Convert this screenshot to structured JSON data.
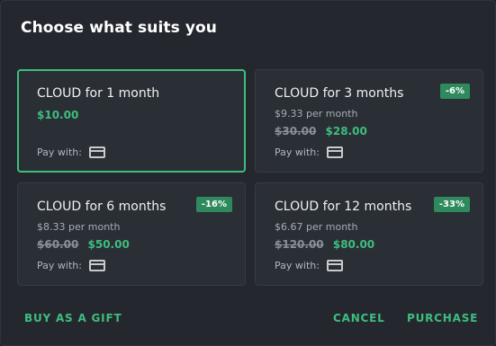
{
  "dialog": {
    "title": "Choose what suits you"
  },
  "plans": [
    {
      "name": "CLOUD for 1 month",
      "per_month": "",
      "old_price": "",
      "price": "$10.00",
      "discount": "",
      "pay_label": "Pay with:",
      "selected": true
    },
    {
      "name": "CLOUD for 3 months",
      "per_month": "$9.33 per month",
      "old_price": "$30.00",
      "price": "$28.00",
      "discount": "-6%",
      "pay_label": "Pay with:",
      "selected": false
    },
    {
      "name": "CLOUD for 6 months",
      "per_month": "$8.33 per month",
      "old_price": "$60.00",
      "price": "$50.00",
      "discount": "-16%",
      "pay_label": "Pay with:",
      "selected": false
    },
    {
      "name": "CLOUD for 12 months",
      "per_month": "$6.67 per month",
      "old_price": "$120.00",
      "price": "$80.00",
      "discount": "-33%",
      "pay_label": "Pay with:",
      "selected": false
    }
  ],
  "payment_icon": "credit-card-icon",
  "footer": {
    "gift_label": "BUY AS A GIFT",
    "cancel_label": "CANCEL",
    "purchase_label": "PURCHASE"
  },
  "colors": {
    "accent": "#3fbd7f",
    "badge": "#2e8a5c",
    "background": "#24282e",
    "card": "#2a2e35"
  }
}
